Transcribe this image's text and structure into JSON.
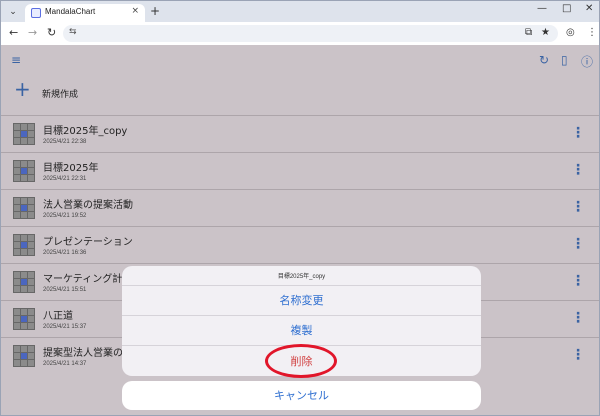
{
  "browser": {
    "tab_title": "MandalaChart",
    "new_tab": "+",
    "tab_close": "×",
    "menu": "⌄"
  },
  "app": {
    "new_create_label": "新規作成",
    "items": [
      {
        "title": "目標2025年_copy",
        "date": "2025/4/21 22:38"
      },
      {
        "title": "目標2025年",
        "date": "2025/4/21 22:31"
      },
      {
        "title": "法人営業の提案活動",
        "date": "2025/4/21 19:52"
      },
      {
        "title": "プレゼンテーション",
        "date": "2025/4/21 16:36"
      },
      {
        "title": "マーケティング計画",
        "date": "2025/4/21 15:51"
      },
      {
        "title": "八正道",
        "date": "2025/4/21 15:37"
      },
      {
        "title": "提案型法人営業の下",
        "date": "2025/4/21 14:37"
      }
    ]
  },
  "action_sheet": {
    "title": "目標2025年_copy",
    "rename": "名称変更",
    "duplicate": "複製",
    "delete": "削除",
    "cancel": "キャンセル"
  },
  "colors": {
    "accent": "#3a63a3",
    "danger": "#d14040",
    "highlight_ring": "#e1162a"
  }
}
